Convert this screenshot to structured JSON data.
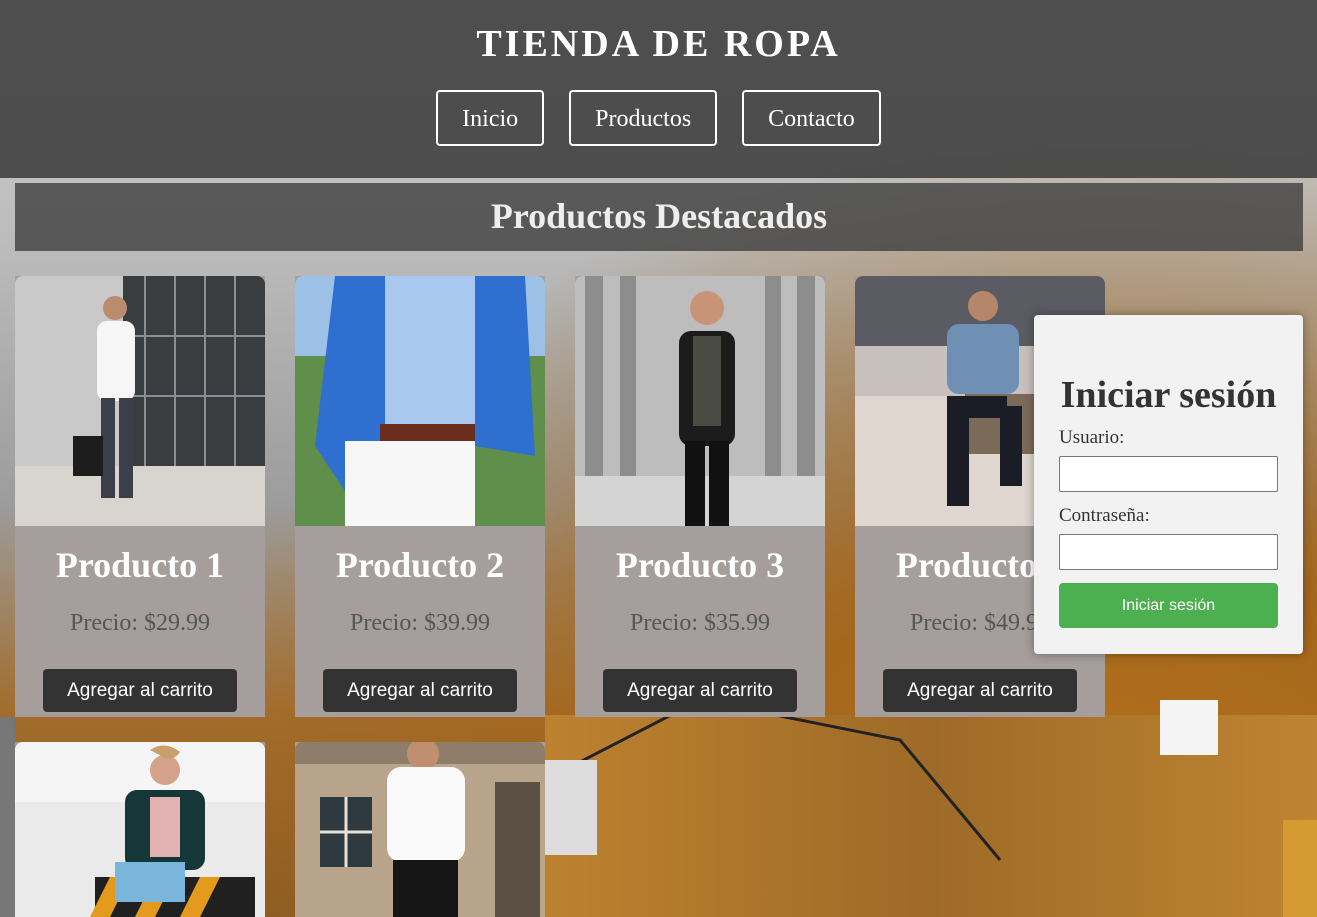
{
  "header": {
    "brand": "TIENDA DE ROPA",
    "nav": [
      {
        "label": "Inicio"
      },
      {
        "label": "Productos"
      },
      {
        "label": "Contacto"
      }
    ]
  },
  "main": {
    "section_title": "Productos Destacados",
    "products": [
      {
        "name": "Producto 1",
        "price": "Precio: $29.99",
        "button": "Agregar al carrito"
      },
      {
        "name": "Producto 2",
        "price": "Precio: $39.99",
        "button": "Agregar al carrito"
      },
      {
        "name": "Producto 3",
        "price": "Precio: $35.99",
        "button": "Agregar al carrito"
      },
      {
        "name": "Producto 4",
        "price": "Precio: $49.99",
        "button": "Agregar al carrito"
      }
    ]
  },
  "login": {
    "title": "Iniciar sesión",
    "user_label": "Usuario:",
    "user_value": "",
    "password_label": "Contraseña:",
    "password_value": "",
    "submit_label": "Iniciar sesión"
  },
  "colors": {
    "header_bg": "#3c3c3c",
    "card_bg": "#a59e9d",
    "button_dark": "#333333",
    "login_button": "#4caf50"
  }
}
